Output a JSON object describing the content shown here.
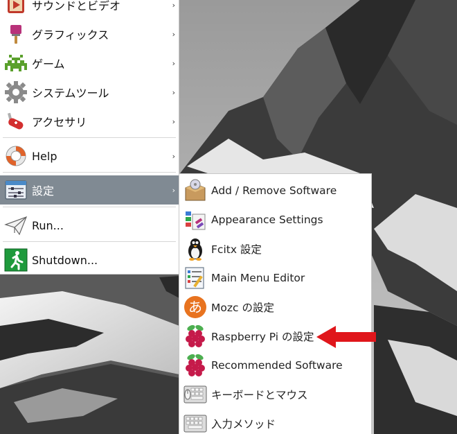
{
  "main_menu": {
    "items": [
      {
        "label": "サウンドとビデオ",
        "icon": "sound-video-icon",
        "arrow": "›"
      },
      {
        "label": "グラフィックス",
        "icon": "graphics-brush-icon",
        "arrow": "›"
      },
      {
        "label": "ゲーム",
        "icon": "game-invader-icon",
        "arrow": "›"
      },
      {
        "label": "システムツール",
        "icon": "gear-icon",
        "arrow": "›"
      },
      {
        "label": "アクセサリ",
        "icon": "swiss-knife-icon",
        "arrow": "›"
      },
      {
        "label": "Help",
        "icon": "lifebuoy-icon",
        "arrow": "›"
      },
      {
        "label": "設定",
        "icon": "settings-sliders-icon",
        "arrow": "›",
        "active": true
      },
      {
        "label": "Run...",
        "icon": "paper-plane-icon"
      },
      {
        "label": "Shutdown...",
        "icon": "exit-running-man-icon"
      }
    ]
  },
  "sub_menu": {
    "items": [
      {
        "label": "Add / Remove Software",
        "icon": "package-box-icon"
      },
      {
        "label": "Appearance Settings",
        "icon": "appearance-palette-icon"
      },
      {
        "label": "Fcitx 設定",
        "icon": "penguin-icon"
      },
      {
        "label": "Main Menu Editor",
        "icon": "menu-editor-icon"
      },
      {
        "label": "Mozc の設定",
        "icon": "mozc-hiragana-icon",
        "glyph": "あ"
      },
      {
        "label": "Raspberry Pi の設定",
        "icon": "raspberry-pi-icon"
      },
      {
        "label": "Recommended Software",
        "icon": "raspberry-pi-icon"
      },
      {
        "label": "キーボードとマウス",
        "icon": "keyboard-mouse-icon"
      },
      {
        "label": "入力メソッド",
        "icon": "input-method-keyboard-icon"
      }
    ]
  },
  "colors": {
    "active_row": "#808a93",
    "annotation_arrow": "#e0161b"
  }
}
